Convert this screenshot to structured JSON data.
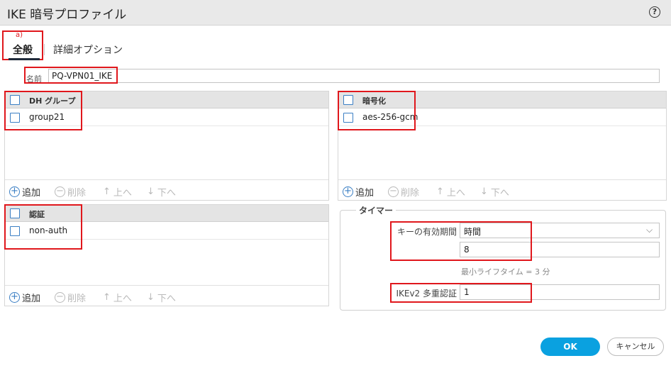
{
  "window": {
    "title": "IKE 暗号プロファイル",
    "help_icon": "?"
  },
  "annotation": {
    "label": "a)"
  },
  "tabs": [
    {
      "label": "全般",
      "active": true
    },
    {
      "label": "詳細オプション",
      "active": false
    }
  ],
  "name_field": {
    "label": "名前",
    "value": "PQ-VPN01_IKE"
  },
  "dh_group": {
    "header": "DH グループ",
    "rows": [
      "group21"
    ]
  },
  "encryption": {
    "header": "暗号化",
    "rows": [
      "aes-256-gcm"
    ]
  },
  "authentication": {
    "header": "認証",
    "rows": [
      "non-auth"
    ]
  },
  "toolbar": {
    "add": "追加",
    "delete": "削除",
    "up": "上へ",
    "down": "下へ"
  },
  "timer": {
    "legend": "タイマー",
    "key_lifetime_label": "キーの有効期間",
    "key_lifetime_unit": "時間",
    "key_lifetime_value": "8",
    "min_lifetime_hint": "最小ライフタイム = 3 分",
    "ikev2_label": "IKEv2 多重認証",
    "ikev2_value": "1"
  },
  "buttons": {
    "ok": "OK",
    "cancel": "キャンセル"
  },
  "colors": {
    "accent": "#0aa1e0",
    "annotation_red": "#e0171c",
    "checkbox_blue": "#3b7fc4"
  }
}
